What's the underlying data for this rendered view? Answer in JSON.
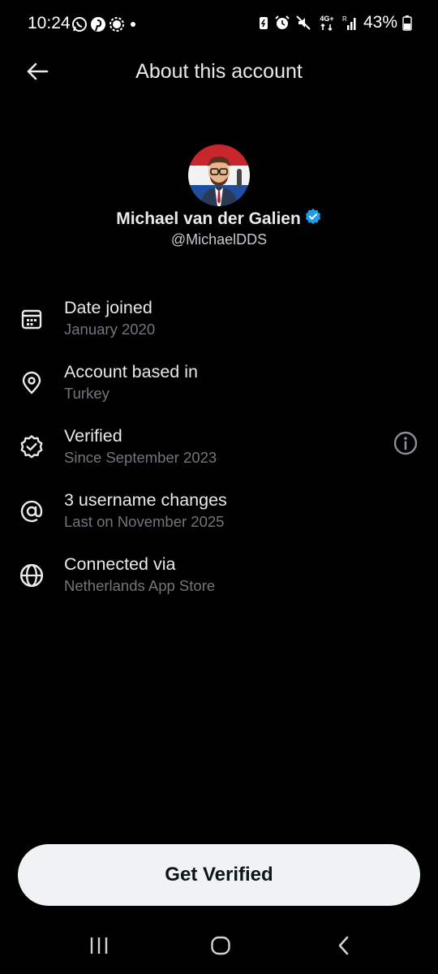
{
  "status_bar": {
    "time": "10:24",
    "battery_percent": "43%",
    "network_label": "4G+",
    "left_icons": [
      "whatsapp-icon",
      "pinterest-icon",
      "signal-icon",
      "dot-icon"
    ],
    "right_icons": [
      "battery-saver-icon",
      "alarm-icon",
      "mute-icon",
      "network-icon",
      "signal-bars-icon",
      "battery-icon"
    ]
  },
  "header": {
    "title": "About this account",
    "back_icon": "arrow-left-icon"
  },
  "profile": {
    "name": "Michael van der Galien",
    "handle": "@MichaelDDS",
    "verified_badge_color": "#1d9bf0"
  },
  "info_items": [
    {
      "icon": "calendar-icon",
      "title": "Date joined",
      "subtitle": "January 2020"
    },
    {
      "icon": "location-pin-icon",
      "title": "Account based in",
      "subtitle": "Turkey"
    },
    {
      "icon": "verified-badge-icon",
      "title": "Verified",
      "subtitle": "Since September 2023"
    },
    {
      "icon": "at-sign-icon",
      "title": "3 username changes",
      "subtitle": "Last on November 2025"
    },
    {
      "icon": "globe-icon",
      "title": "Connected via",
      "subtitle": "Netherlands App Store"
    }
  ],
  "cta": {
    "label": "Get Verified"
  },
  "nav": {
    "icons": [
      "recent-apps-icon",
      "home-icon",
      "back-icon"
    ]
  },
  "colors": {
    "background": "#000000",
    "primary_text": "#e7e9ea",
    "secondary_text": "#71767b",
    "accent": "#1d9bf0",
    "button_bg": "#eff3f4"
  }
}
